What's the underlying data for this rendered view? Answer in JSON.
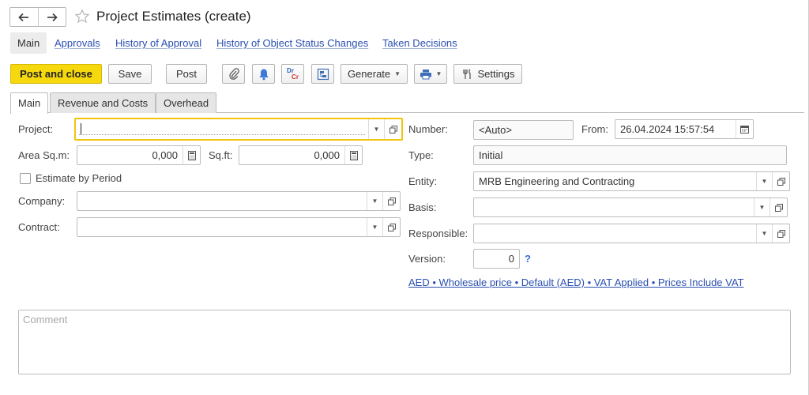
{
  "window": {
    "title": "Project Estimates (create)"
  },
  "sections": {
    "main": "Main",
    "links": [
      "Approvals",
      "History of Approval",
      "History of Object Status Changes",
      "Taken Decisions"
    ]
  },
  "toolbar": {
    "post_close": "Post and close",
    "save": "Save",
    "post": "Post",
    "drcr_top": "Dr",
    "drcr_bottom": "Cr",
    "generate": "Generate",
    "settings": "Settings"
  },
  "tabs": [
    "Main",
    "Revenue and Costs",
    "Overhead"
  ],
  "form": {
    "project_label": "Project:",
    "project_value": "",
    "area_sqm_label": "Area Sq.m:",
    "area_sqm_value": "0,000",
    "sqft_label": "Sq.ft:",
    "sqft_value": "0,000",
    "estimate_by_period_label": "Estimate by Period",
    "estimate_by_period_checked": false,
    "company_label": "Company:",
    "company_value": "",
    "contract_label": "Contract:",
    "contract_value": "",
    "number_label": "Number:",
    "number_placeholder": "<Auto>",
    "from_label": "From:",
    "from_value": "26.04.2024 15:57:54",
    "type_label": "Type:",
    "type_value": "Initial",
    "entity_label": "Entity:",
    "entity_value": "MRB Engineering and Contracting",
    "basis_label": "Basis:",
    "basis_value": "",
    "responsible_label": "Responsible:",
    "responsible_value": "",
    "version_label": "Version:",
    "version_value": "0",
    "version_help": "?",
    "pricing_link": "AED • Wholesale price • Default (AED) • VAT Applied • Prices Include VAT",
    "comment_placeholder": "Comment"
  }
}
